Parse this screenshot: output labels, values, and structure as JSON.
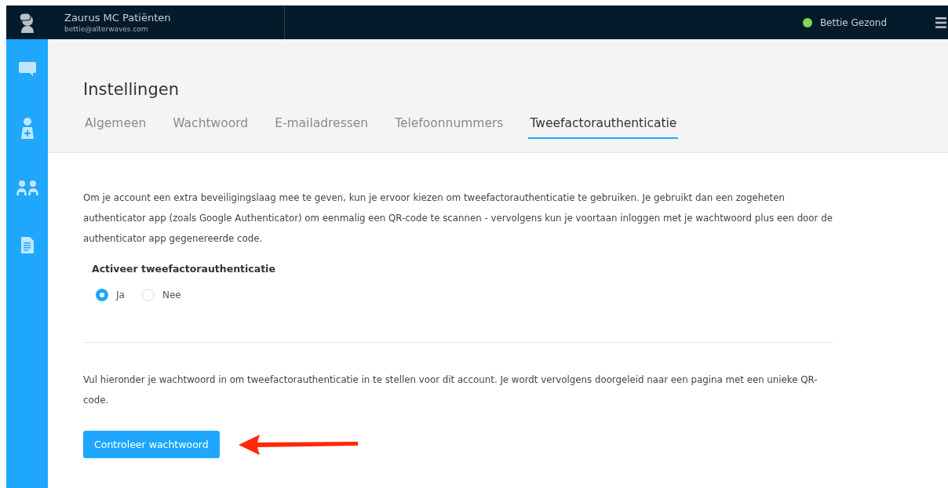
{
  "header": {
    "app_title": "Zaurus MC Patiënten",
    "email": "bettie@alterwaves.com",
    "user": {
      "name": "Bettie Gezond",
      "online": true
    }
  },
  "sidebar": {
    "items": [
      {
        "kind": "chat"
      },
      {
        "kind": "nurse"
      },
      {
        "kind": "people"
      },
      {
        "kind": "document"
      }
    ]
  },
  "page_title": "Instellingen",
  "tabs": [
    {
      "label": "Algemeen",
      "selected": false
    },
    {
      "label": "Wachtwoord",
      "selected": false
    },
    {
      "label": "E-mailadressen",
      "selected": false
    },
    {
      "label": "Telefoonnummers",
      "selected": false
    },
    {
      "label": "Tweefactorauthenticatie",
      "selected": true
    }
  ],
  "intro": "Om je account een extra beveiligingslaag mee te geven, kun je ervoor kiezen om tweefactorauthenticatie te gebruiken. Je gebruikt dan een zogeheten authenticator app (zoals Google Authenticator) om eenmalig een QR-code te scannen - vervolgens kun je voortaan inloggen met je wachtwoord plus een door de authenticator app gegenereerde code.",
  "activate": {
    "label": "Activeer tweefactorauthenticatie",
    "options": [
      {
        "label": "Ja",
        "selected": true
      },
      {
        "label": "Nee",
        "selected": false
      }
    ]
  },
  "password_note": "Vul hieronder je wachtwoord in om tweefactorauthenticatie in te stellen voor dit account. Je wordt vervolgens doorgeleid naar een pagina met een unieke QR-code.",
  "button": "Controleer wachtwoord"
}
